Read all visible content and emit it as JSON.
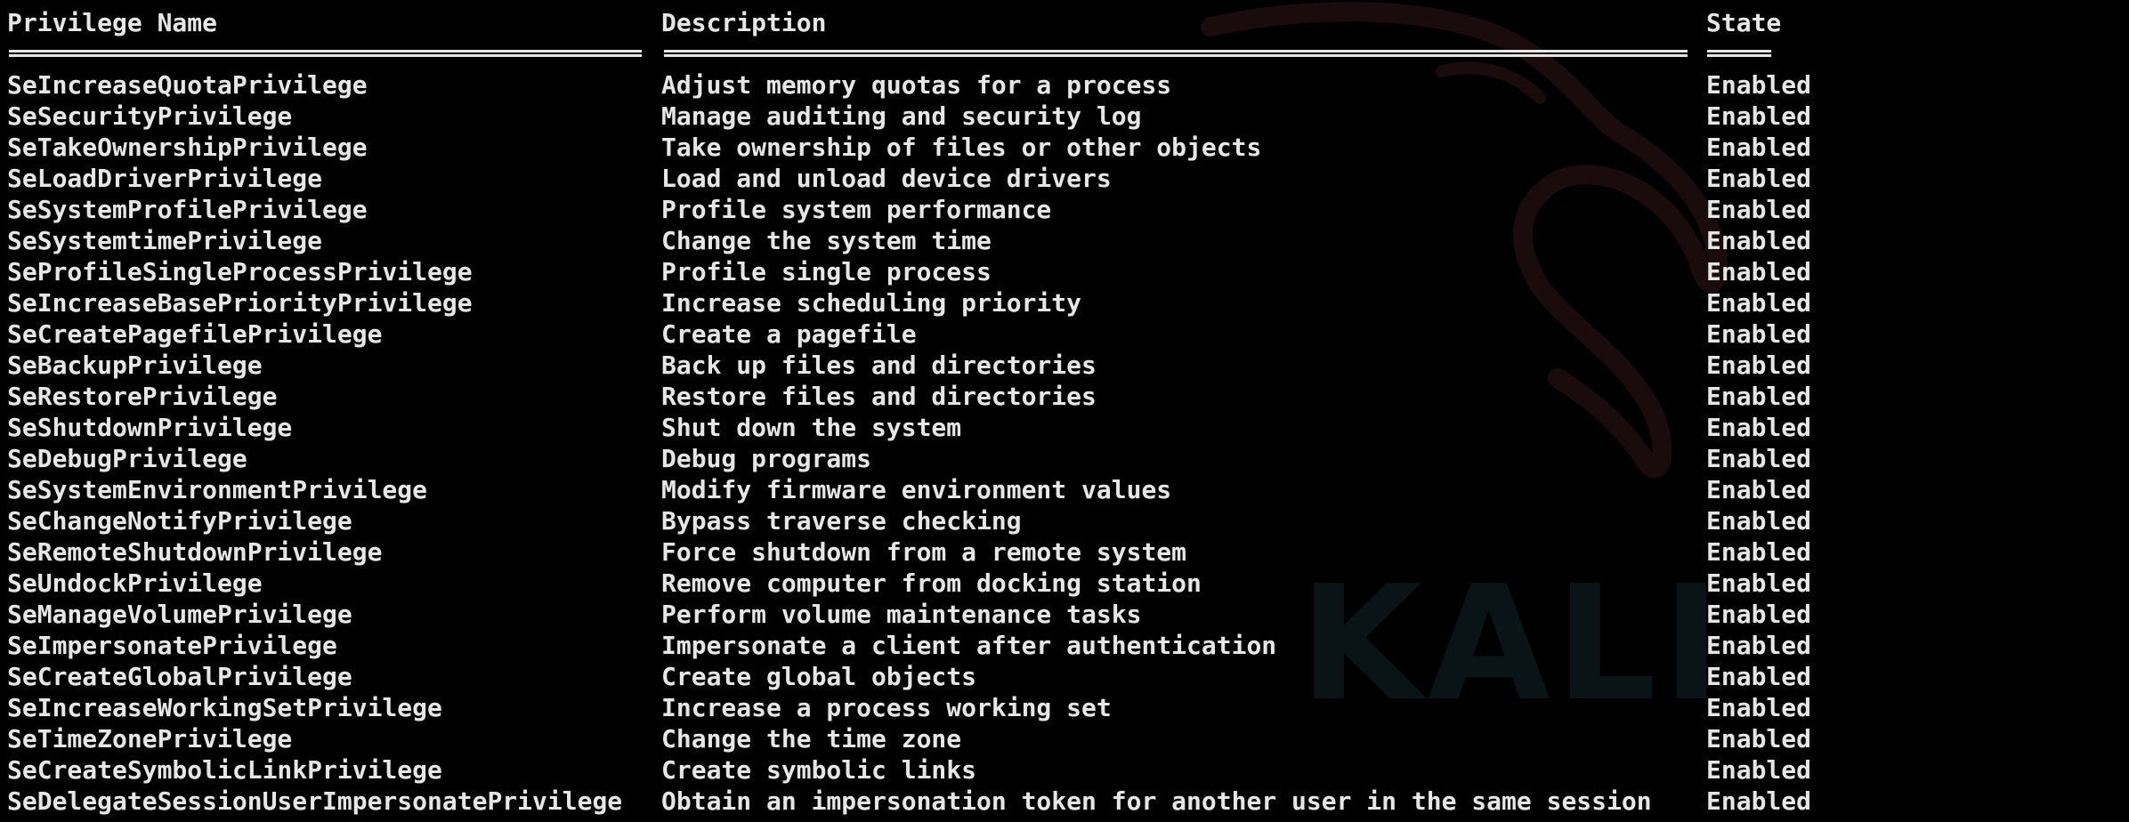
{
  "headers": {
    "name": "Privilege Name",
    "description": "Description",
    "state": "State"
  },
  "rows": [
    {
      "name": "SeIncreaseQuotaPrivilege",
      "description": "Adjust memory quotas for a process",
      "state": "Enabled"
    },
    {
      "name": "SeSecurityPrivilege",
      "description": "Manage auditing and security log",
      "state": "Enabled"
    },
    {
      "name": "SeTakeOwnershipPrivilege",
      "description": "Take ownership of files or other objects",
      "state": "Enabled"
    },
    {
      "name": "SeLoadDriverPrivilege",
      "description": "Load and unload device drivers",
      "state": "Enabled"
    },
    {
      "name": "SeSystemProfilePrivilege",
      "description": "Profile system performance",
      "state": "Enabled"
    },
    {
      "name": "SeSystemtimePrivilege",
      "description": "Change the system time",
      "state": "Enabled"
    },
    {
      "name": "SeProfileSingleProcessPrivilege",
      "description": "Profile single process",
      "state": "Enabled"
    },
    {
      "name": "SeIncreaseBasePriorityPrivilege",
      "description": "Increase scheduling priority",
      "state": "Enabled"
    },
    {
      "name": "SeCreatePagefilePrivilege",
      "description": "Create a pagefile",
      "state": "Enabled"
    },
    {
      "name": "SeBackupPrivilege",
      "description": "Back up files and directories",
      "state": "Enabled"
    },
    {
      "name": "SeRestorePrivilege",
      "description": "Restore files and directories",
      "state": "Enabled"
    },
    {
      "name": "SeShutdownPrivilege",
      "description": "Shut down the system",
      "state": "Enabled"
    },
    {
      "name": "SeDebugPrivilege",
      "description": "Debug programs",
      "state": "Enabled"
    },
    {
      "name": "SeSystemEnvironmentPrivilege",
      "description": "Modify firmware environment values",
      "state": "Enabled"
    },
    {
      "name": "SeChangeNotifyPrivilege",
      "description": "Bypass traverse checking",
      "state": "Enabled"
    },
    {
      "name": "SeRemoteShutdownPrivilege",
      "description": "Force shutdown from a remote system",
      "state": "Enabled"
    },
    {
      "name": "SeUndockPrivilege",
      "description": "Remove computer from docking station",
      "state": "Enabled"
    },
    {
      "name": "SeManageVolumePrivilege",
      "description": "Perform volume maintenance tasks",
      "state": "Enabled"
    },
    {
      "name": "SeImpersonatePrivilege",
      "description": "Impersonate a client after authentication",
      "state": "Enabled"
    },
    {
      "name": "SeCreateGlobalPrivilege",
      "description": "Create global objects",
      "state": "Enabled"
    },
    {
      "name": "SeIncreaseWorkingSetPrivilege",
      "description": "Increase a process working set",
      "state": "Enabled"
    },
    {
      "name": "SeTimeZonePrivilege",
      "description": "Change the time zone",
      "state": "Enabled"
    },
    {
      "name": "SeCreateSymbolicLinkPrivilege",
      "description": "Create symbolic links",
      "state": "Enabled"
    },
    {
      "name": "SeDelegateSessionUserImpersonatePrivilege",
      "description": "Obtain an impersonation token for another user in the same session",
      "state": "Enabled"
    }
  ],
  "watermark": {
    "icon": "kali-dragon-icon",
    "text": "KALI"
  },
  "colors": {
    "background": "#000000",
    "text": "#e6e6e6",
    "watermark": "#0a1416"
  }
}
